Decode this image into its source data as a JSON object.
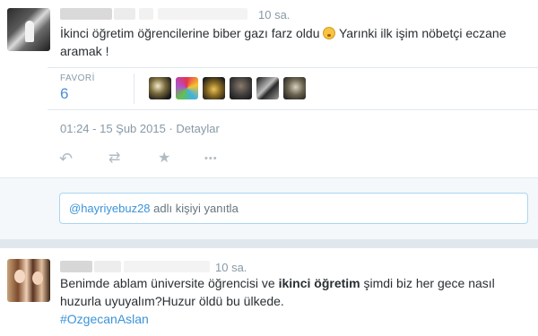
{
  "tweet1": {
    "time": "10 sa.",
    "text_main": "İkinci öğretim öğrencilerine biber gazı farz oldu",
    "text_rest": " Yarınki ilk işim nöbetçi eczane aramak !",
    "emoji_icon": "flushed-face-icon",
    "favorites": {
      "label": "FAVORİ",
      "count": "6"
    },
    "date": "01:24 - 15 Şub 2015",
    "date_sep": " · ",
    "details_link": "Detaylar",
    "actions": {
      "reply_icon": "↶",
      "retweet_icon": "⇄",
      "favorite_icon": "★",
      "more_icon": "•••"
    }
  },
  "reply": {
    "handle": "@hayriyebuz28",
    "suffix": " adlı kişiyi yanıtla"
  },
  "tweet2": {
    "time": "10 sa.",
    "text_before": "Benimde ablam üniversite öğrencisi ve ",
    "text_bold": "ikinci öğretim",
    "text_after": " şimdi biz her gece nasıl huzurla uyuyalım?Huzur öldü bu ülkede.",
    "hashtag": "#OzgecanAslan"
  },
  "colors": {
    "accent": "#4a8fd5",
    "link": "#3b94d9",
    "muted": "#8899a6",
    "text": "#292f33"
  }
}
